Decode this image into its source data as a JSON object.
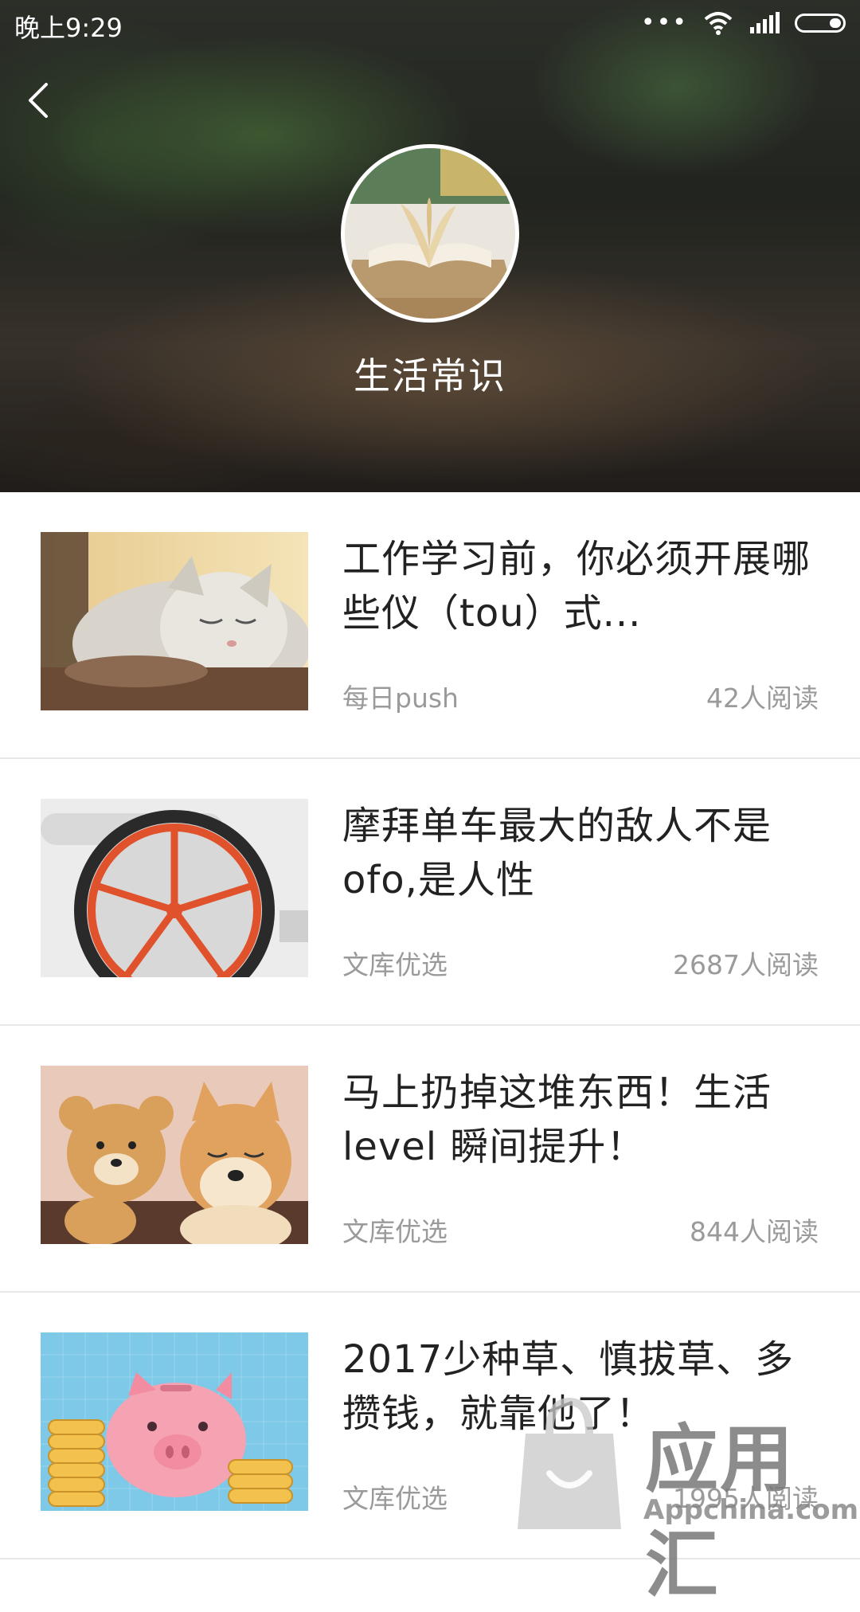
{
  "status_bar": {
    "time": "晚上9:29",
    "signal_dots": "•••",
    "icons": [
      "wifi-icon",
      "signal-icon",
      "battery-icon"
    ]
  },
  "header": {
    "back_icon": "chevron-left-icon",
    "title": "生活常识",
    "avatar_icon": "open-book-image"
  },
  "feed": [
    {
      "title": "工作学习前，你必须开展哪些仪（tou）式...",
      "source": "每日push",
      "reads": "42人阅读",
      "thumb": "sleeping-cat-image"
    },
    {
      "title": "摩拜单车最大的敌人不是ofo,是人性",
      "source": "文库优选",
      "reads": "2687人阅读",
      "thumb": "bike-wheel-image"
    },
    {
      "title": "马上扔掉这堆东西！生活level 瞬间提升！",
      "source": "文库优选",
      "reads": "844人阅读",
      "thumb": "bear-and-shiba-image"
    },
    {
      "title": "2017少种草、慎拔草、多攒钱，就靠他了！",
      "source": "文库优选",
      "reads": "1995人阅读",
      "thumb": "piggy-bank-image"
    }
  ],
  "watermark": {
    "text": "应用汇",
    "sub": "Appchina.com"
  },
  "colors": {
    "title_text": "#222222",
    "meta_text": "#9a9a9a",
    "divider": "#e8e8e8",
    "bike_orange": "#e0522c",
    "piggy_pink": "#f5a3b3",
    "sky_blue": "#7ec8e8"
  }
}
